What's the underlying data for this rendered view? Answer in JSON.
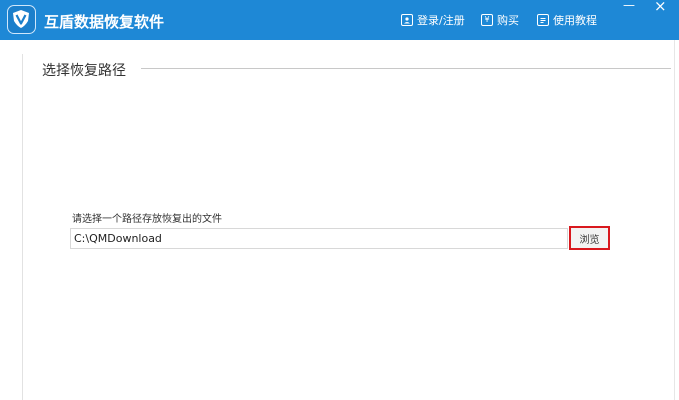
{
  "app": {
    "title": "互盾数据恢复软件"
  },
  "nav": {
    "login_label": "登录/注册",
    "buy_label": "购买",
    "tutorial_label": "使用教程"
  },
  "window_controls": {
    "minimize": "—",
    "close": "×"
  },
  "section": {
    "title": "选择恢复路径"
  },
  "path_picker": {
    "label": "请选择一个路径存放恢复出的文件",
    "value": "C:\\QMDownload",
    "browse_label": "浏览"
  },
  "colors": {
    "titlebar": "#1e88d6",
    "highlight_border": "#d9181e"
  }
}
